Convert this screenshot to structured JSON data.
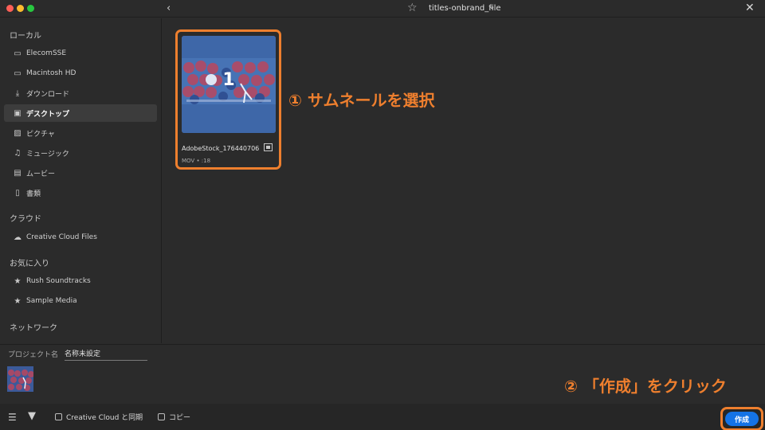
{
  "window": {
    "title": "titles-onbrand_file"
  },
  "sidebar": {
    "sections": {
      "local": "ローカル",
      "cloud": "クラウド",
      "favorites": "お気に入り",
      "network": "ネットワーク"
    },
    "local_items": [
      {
        "label": "ElecomSSE",
        "icon": "monitor-icon"
      },
      {
        "label": "Macintosh HD",
        "icon": "monitor-icon"
      },
      {
        "label": "ダウンロード",
        "icon": "download-icon"
      },
      {
        "label": "デスクトップ",
        "icon": "desktop-icon",
        "active": true
      },
      {
        "label": "ピクチャ",
        "icon": "image-icon"
      },
      {
        "label": "ミュージック",
        "icon": "music-icon"
      },
      {
        "label": "ムービー",
        "icon": "film-icon"
      },
      {
        "label": "書類",
        "icon": "document-icon"
      }
    ],
    "cloud_items": [
      {
        "label": "Creative Cloud Files",
        "icon": "creative-cloud-icon"
      }
    ],
    "favorite_items": [
      {
        "label": "Rush Soundtracks",
        "icon": "star-icon"
      },
      {
        "label": "Sample Media",
        "icon": "star-icon"
      }
    ]
  },
  "main": {
    "thumbnail": {
      "number": "1",
      "name": "AdobeStock_176440706",
      "meta": "MOV • :18"
    },
    "annotation_1": "① サムネールを選択"
  },
  "bottom": {
    "project_label": "プロジェクト名",
    "project_name": "名称未設定",
    "annotation_2": "② 「作成」をクリック",
    "sync_label": "Creative Cloud と同期",
    "copy_label": "コピー",
    "create_label": "作成"
  },
  "colors": {
    "accent_orange": "#ee7f2e",
    "primary_blue": "#1473e6",
    "background": "#2b2b2b"
  }
}
